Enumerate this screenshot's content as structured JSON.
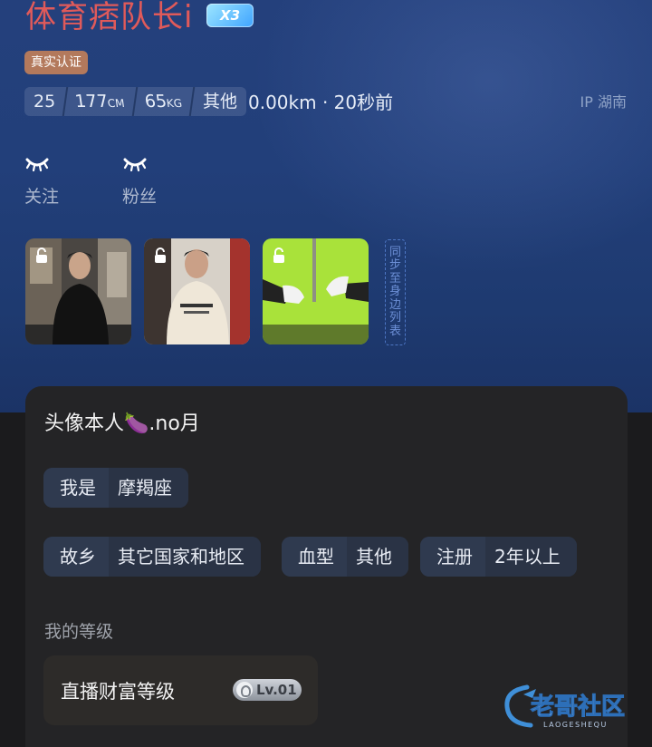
{
  "profile": {
    "name": "体育痞队长i",
    "vip_level": "3",
    "verified_label": "真实认证",
    "stats": [
      {
        "value": "25",
        "unit": ""
      },
      {
        "value": "177",
        "unit": "CM"
      },
      {
        "value": "65",
        "unit": "KG"
      },
      {
        "value": "其他",
        "unit": ""
      }
    ],
    "distance": "0.00km · 20秒前",
    "ip_location": "IP 湖南",
    "following_label": "关注",
    "followers_label": "粉丝",
    "sync_label": "同步至身边列表"
  },
  "details": {
    "bio": "头像本人🍆.no月",
    "tags_row1": [
      {
        "key": "我是",
        "value": "摩羯座"
      }
    ],
    "tags_row2": [
      {
        "key": "故乡",
        "value": "其它国家和地区"
      },
      {
        "key": "血型",
        "value": "其他"
      },
      {
        "key": "注册",
        "value": "2年以上"
      }
    ],
    "level_section_title": "我的等级",
    "level_label": "直播财富等级",
    "level_value": "Lv.01"
  },
  "watermark": {
    "title": "老哥社区",
    "subtitle": "LAOGESHEQU"
  },
  "colors": {
    "name": "#e05a5a",
    "hero_bg": "#223f7a",
    "card_bg": "#242426",
    "verified_bg": "#b3795c",
    "chip_bg": "#2f3a4f"
  },
  "icons": [
    "lock-icon",
    "eyelash-icon",
    "vip-badge-icon",
    "level-icon"
  ]
}
